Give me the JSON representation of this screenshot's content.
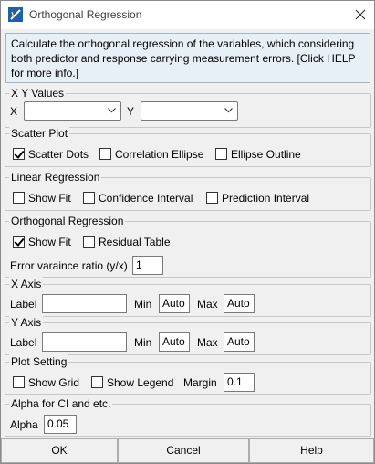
{
  "window": {
    "title": "Orthogonal Regression",
    "icon": "app-icon",
    "close_icon": "close-icon"
  },
  "description": "Calculate the orthogonal regression of the variables, which considering both predictor and response carrying measurement errors. [Click HELP for more info.]",
  "xy_values": {
    "legend": "X Y Values",
    "x_label": "X",
    "x_value": "",
    "y_label": "Y",
    "y_value": ""
  },
  "scatter_plot": {
    "legend": "Scatter Plot",
    "options": [
      {
        "label": "Scatter Dots",
        "checked": true
      },
      {
        "label": "Correlation Ellipse",
        "checked": false
      },
      {
        "label": "Ellipse Outline",
        "checked": false
      }
    ]
  },
  "linear_regression": {
    "legend": "Linear Regression",
    "options": [
      {
        "label": "Show Fit",
        "checked": false
      },
      {
        "label": "Confidence Interval",
        "checked": false
      },
      {
        "label": "Prediction Interval",
        "checked": false
      }
    ]
  },
  "orthogonal_regression": {
    "legend": "Orthogonal Regression",
    "options": [
      {
        "label": "Show Fit",
        "checked": true
      },
      {
        "label": "Residual Table",
        "checked": false
      }
    ],
    "ratio_label": "Error varaince ratio (y/x)",
    "ratio_value": "1"
  },
  "x_axis": {
    "legend": "X Axis",
    "label_label": "Label",
    "label_value": "",
    "min_label": "Min",
    "min_value": "Auto",
    "max_label": "Max",
    "max_value": "Auto"
  },
  "y_axis": {
    "legend": "Y Axis",
    "label_label": "Label",
    "label_value": "",
    "min_label": "Min",
    "min_value": "Auto",
    "max_label": "Max",
    "max_value": "Auto"
  },
  "plot_setting": {
    "legend": "Plot Setting",
    "options": [
      {
        "label": "Show Grid",
        "checked": false
      },
      {
        "label": "Show Legend",
        "checked": false
      }
    ],
    "margin_label": "Margin",
    "margin_value": "0.1"
  },
  "alpha": {
    "legend": "Alpha for CI and etc.",
    "alpha_label": "Alpha",
    "alpha_value": "0.05"
  },
  "buttons": {
    "ok": "OK",
    "cancel": "Cancel",
    "help": "Help"
  }
}
